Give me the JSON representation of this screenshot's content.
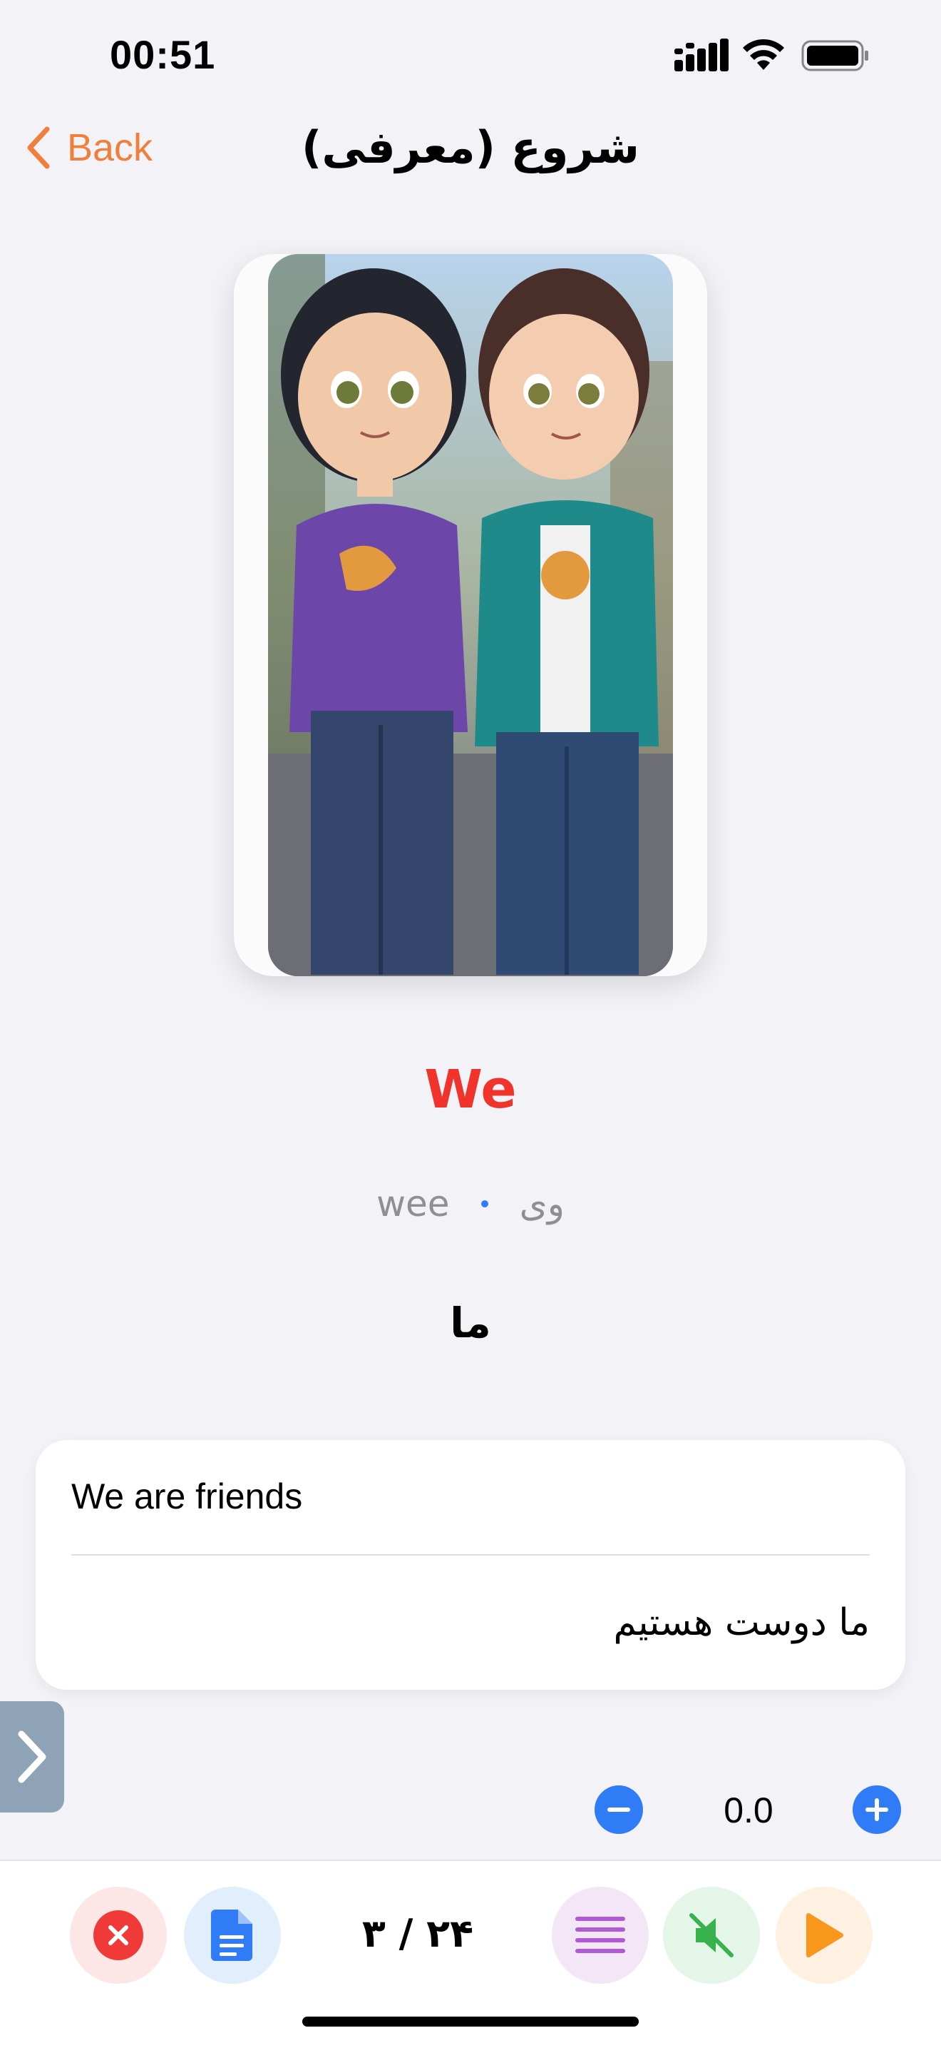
{
  "status_bar": {
    "time": "00:51"
  },
  "nav": {
    "back_label": "Back",
    "title": "شروع (معرفی)"
  },
  "word": {
    "term": "We",
    "pronunciation_en": "wee",
    "pronunciation_fa": "وی",
    "meaning": "ما",
    "image": "two cartoon boys standing together"
  },
  "sentence": {
    "en": "We are friends",
    "fa": "ما دوست هستیم"
  },
  "speed": {
    "value": "0.0"
  },
  "bottom_bar": {
    "counter": "۳ / ۲۴"
  },
  "icons": {
    "back": "chevron-left-icon",
    "close": "close-icon",
    "doc": "document-icon",
    "list": "list-icon",
    "mute": "speaker-mute-icon",
    "play": "play-icon",
    "next": "chevron-right-icon",
    "minus": "minus-circle-icon",
    "plus": "plus-circle-icon"
  },
  "colors": {
    "accent_orange": "#f07f3c",
    "word_red": "#f0342c",
    "blue": "#2f7cf6",
    "background": "#f2f2f7"
  }
}
